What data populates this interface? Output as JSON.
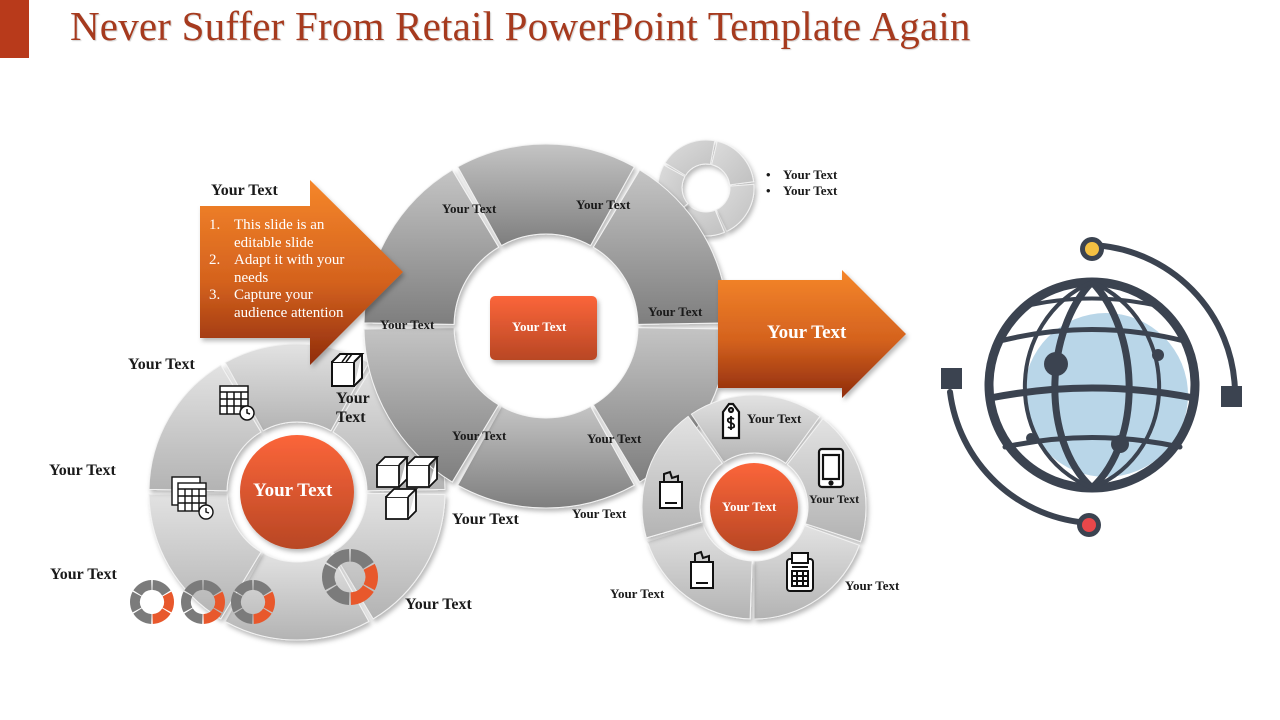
{
  "slide": {
    "title": "Never Suffer From Retail PowerPoint Template Again",
    "accent_color": "#b83a1b",
    "title_color": "#a63a1e"
  },
  "left_arrow": {
    "heading": "Your Text",
    "items": [
      {
        "num": "1.",
        "text": "This slide is an editable slide"
      },
      {
        "num": "2.",
        "text": "Adapt it with your needs"
      },
      {
        "num": "3.",
        "text": "Capture your audience attention"
      }
    ]
  },
  "main_wheel": {
    "center_label": "Your Text",
    "segments": [
      {
        "label": "Your Text"
      },
      {
        "label": "Your Text"
      },
      {
        "label": "Your Text"
      },
      {
        "label": "Your Text"
      },
      {
        "label": "Your Text"
      },
      {
        "label": "Your Text"
      }
    ]
  },
  "mini_donut_legend": {
    "items": [
      {
        "bullet": "•",
        "text": "Your Text"
      },
      {
        "bullet": "•",
        "text": "Your Text"
      }
    ]
  },
  "right_arrow": {
    "label": "Your Text"
  },
  "left_wheel": {
    "center_label": "Your Text",
    "segments": [
      {
        "label": "Your Text",
        "icon": "calendar-icon"
      },
      {
        "label": "Your Text",
        "icon": "box-icon"
      },
      {
        "label": "Your Text",
        "icon": "boxes-stack-icon"
      },
      {
        "label": "Your Text",
        "icon": "donut-progress-icon"
      },
      {
        "label": "Your Text",
        "icon": "donut-progress-row-icon"
      },
      {
        "label": "Your Text",
        "icon": "calendars-icon"
      }
    ]
  },
  "right_wheel": {
    "center_label": "Your Text",
    "segments": [
      {
        "label": "Your Text",
        "icon": "price-tag-icon"
      },
      {
        "label": "Your Text",
        "icon": "smartphone-icon"
      },
      {
        "label": "Your Text",
        "icon": "pos-terminal-icon"
      },
      {
        "label": "Your Text",
        "icon": "shopping-bag-icon"
      },
      {
        "label": "Your Text",
        "icon": "shopping-bag-icon"
      }
    ]
  },
  "globe": {
    "icon": "globe-network-icon",
    "colors": {
      "stroke": "#3b4350",
      "fill": "#b9d6e8",
      "dot_top": "#f4c042",
      "dot_bottom": "#e8474a"
    }
  }
}
